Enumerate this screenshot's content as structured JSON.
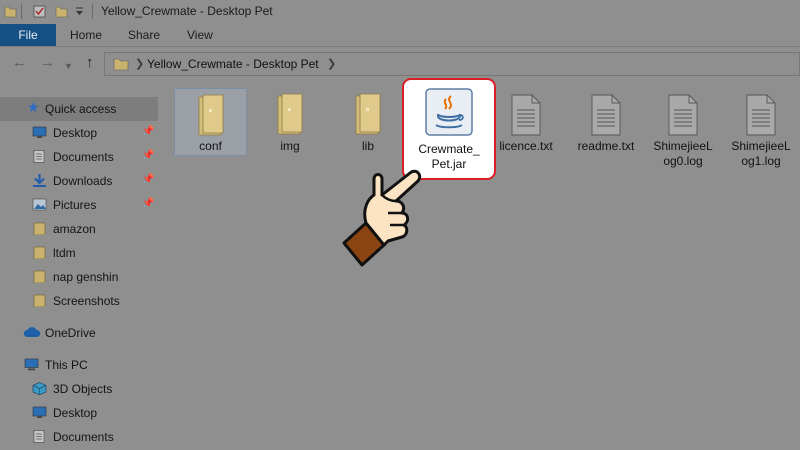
{
  "window": {
    "title": "Yellow_Crewmate - Desktop Pet"
  },
  "ribbon": {
    "file_label": "File",
    "tabs": [
      {
        "label": "Home"
      },
      {
        "label": "Share"
      },
      {
        "label": "View"
      }
    ]
  },
  "address": {
    "path": "Yellow_Crewmate - Desktop Pet"
  },
  "nav": {
    "quick_access": "Quick access",
    "items": [
      {
        "label": "Desktop",
        "icon": "desktop-icon",
        "pinned": true
      },
      {
        "label": "Documents",
        "icon": "documents-icon",
        "pinned": true
      },
      {
        "label": "Downloads",
        "icon": "downloads-icon",
        "pinned": true
      },
      {
        "label": "Pictures",
        "icon": "pictures-icon",
        "pinned": true
      },
      {
        "label": "amazon",
        "icon": "folder-icon",
        "pinned": false
      },
      {
        "label": "ltdm",
        "icon": "folder-icon",
        "pinned": false
      },
      {
        "label": "nap genshin",
        "icon": "folder-icon",
        "pinned": false
      },
      {
        "label": "Screenshots",
        "icon": "folder-icon",
        "pinned": false
      }
    ],
    "onedrive": "OneDrive",
    "this_pc": "This PC",
    "pc_items": [
      {
        "label": "3D Objects",
        "icon": "3d-objects-icon"
      },
      {
        "label": "Desktop",
        "icon": "desktop-icon"
      },
      {
        "label": "Documents",
        "icon": "documents-icon"
      }
    ]
  },
  "files": [
    {
      "name": "conf",
      "type": "folder"
    },
    {
      "name": "img",
      "type": "folder"
    },
    {
      "name": "lib",
      "type": "folder"
    },
    {
      "name": "Crewmate_Pet.jar",
      "name_line1": "Crewmate_",
      "name_line2": "Pet.jar",
      "type": "java-jar",
      "highlighted": true
    },
    {
      "name": "licence.txt",
      "type": "text"
    },
    {
      "name": "readme.txt",
      "type": "text"
    },
    {
      "name": "ShimejieeLog0.log",
      "name_line1": "ShimejieeL",
      "name_line2": "og0.log",
      "type": "text"
    },
    {
      "name": "ShimejieeLog1.log",
      "name_line1": "ShimejieeL",
      "name_line2": "og1.log",
      "type": "text"
    }
  ],
  "colors": {
    "background": "#8f8f8f",
    "file_tab": "#154f84",
    "highlight_border": "#d81f26",
    "folder": "#d9c58a",
    "hand_skin": "#fbe3c3",
    "hand_cuff": "#8b4513"
  }
}
